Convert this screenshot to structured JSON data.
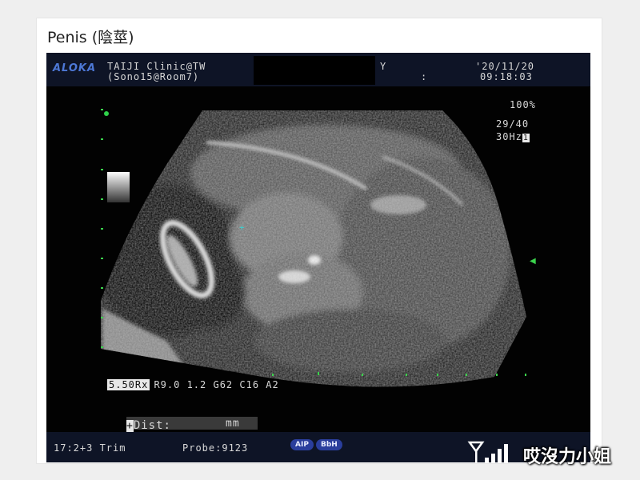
{
  "caption": "Penis (陰莖)",
  "screen": {
    "brand": "ALOKA",
    "clinic": "TAIJI Clinic@TW",
    "room": "(Sono15@Room7)",
    "y_label": "Y",
    "colon": ":",
    "date": "'20/11/20",
    "time": "09:18:03",
    "zoom": "100%",
    "frame": "29/40",
    "freq": "30Hz",
    "freq_box": "1",
    "settings_box": "5.50Rx",
    "settings": "R9.0 1.2 G62 C16 A2",
    "dist_plus": "+",
    "dist_label": "Dist:",
    "dist_unit": "mm",
    "trim": "17:2+3 Trim",
    "probe": "Probe:9123",
    "badge1": "AIP",
    "badge2": "BbH",
    "marker": "+",
    "arrow": "◀",
    "colors": {
      "accent_green": "#3bd24c",
      "brand_blue": "#4d78d6",
      "badge_blue": "#2a3e9c"
    }
  },
  "watermark": {
    "text": "哎沒力小姐",
    "icon": "signal-icon"
  }
}
